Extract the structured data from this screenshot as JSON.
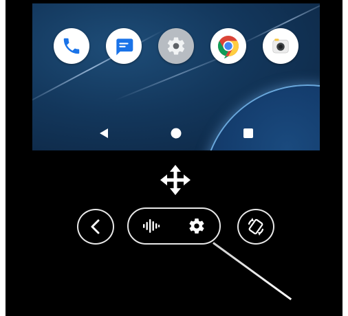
{
  "colors": {
    "frame_bg": "#000000",
    "wallpaper": "#13375c",
    "planet_outline": "#6aa8dc",
    "control_outline": "#e8e8e8",
    "icon_white": "#ffffff"
  },
  "home_screen": {
    "dock_apps": [
      {
        "name": "phone",
        "icon": "phone-icon",
        "bg": "#ffffff",
        "fg": "#1a73e8"
      },
      {
        "name": "messages",
        "icon": "messages-icon",
        "bg": "#ffffff",
        "fg": "#1a73e8"
      },
      {
        "name": "settings",
        "icon": "gear-icon",
        "bg": "#b7bcc2",
        "fg": "#5f6368"
      },
      {
        "name": "chrome",
        "icon": "chrome-icon",
        "bg": "#ffffff",
        "fg": "#4285f4"
      },
      {
        "name": "camera",
        "icon": "camera-icon",
        "bg": "#ffffff",
        "fg": "#3c4043"
      }
    ],
    "nav_buttons": [
      "back-icon",
      "home-icon",
      "recents-icon"
    ]
  },
  "controls": {
    "move_icon": "move-arrows-icon",
    "back_button_icon": "chevron-left-icon",
    "pill_icons": [
      "sound-wave-icon",
      "gear-icon"
    ],
    "rotate_button_icon": "rotate-screen-icon"
  }
}
